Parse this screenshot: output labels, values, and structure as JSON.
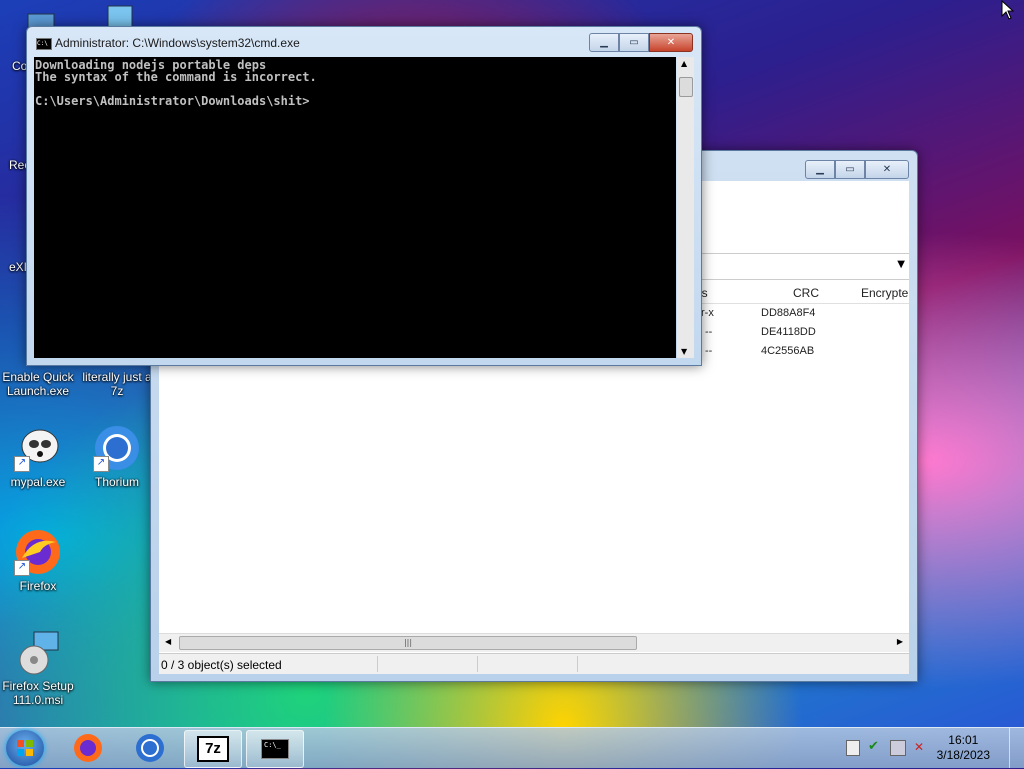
{
  "desktop": {
    "icons": [
      {
        "label": "Co"
      },
      {
        "label": "Rec"
      },
      {
        "label": "eXI"
      },
      {
        "label": "Enable Quick Launch.exe"
      },
      {
        "label": "literally just a 7z"
      },
      {
        "label": "mypal.exe"
      },
      {
        "label": "Thorium"
      },
      {
        "label": "Firefox"
      },
      {
        "label": "Firefox Setup 111.0.msi"
      }
    ]
  },
  "cmd": {
    "title": "Administrator: C:\\Windows\\system32\\cmd.exe",
    "lines": [
      "Downloading nodejs portable deps",
      "The syntax of the command is incorrect.",
      "",
      "C:\\Users\\Administrator\\Downloads\\shit>"
    ]
  },
  "sevenzip": {
    "columns": {
      "attributes": "es",
      "crc": "CRC",
      "encrypted": "Encrypte"
    },
    "rows": [
      {
        "attr": "r-x",
        "crc": "DD88A8F4"
      },
      {
        "attr": "--",
        "crc": "DE4118DD"
      },
      {
        "attr": "--",
        "crc": "4C2556AB"
      }
    ],
    "status": "0 / 3 object(s) selected",
    "scroll_grip": "|||"
  },
  "taskbar": {
    "clock_time": "16:01",
    "clock_date": "3/18/2023",
    "sevenzip_label": "7z",
    "cmd_label": "C:\\_"
  }
}
